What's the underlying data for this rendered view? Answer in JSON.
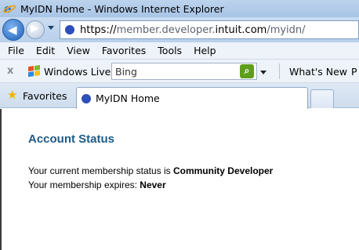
{
  "window": {
    "title": "MyIDN Home - Windows Internet Explorer"
  },
  "navigation": {
    "url_scheme": "https://",
    "url_prefix": "member.developer.",
    "url_host": "intuit.com",
    "url_path": "/myidn/"
  },
  "menu": [
    "File",
    "Edit",
    "View",
    "Favorites",
    "Tools",
    "Help"
  ],
  "toolbar": {
    "close_label": "x",
    "live_label": "Windows Live",
    "search_value": "Bing",
    "whats_new": "What's New",
    "overflow_label": "P"
  },
  "tabs": {
    "favorites_label": "Favorites",
    "active_tab_label": "MyIDN Home"
  },
  "content": {
    "heading": "Account Status",
    "status_prefix": "Your current membership status is ",
    "status_value": "Community Developer",
    "expire_prefix": "Your membership expires: ",
    "expire_value": "Never"
  },
  "colors": {
    "heading": "#1c5b87",
    "site_icon": "#2e4eb8",
    "search_go": "#5e9e1c"
  },
  "icons": [
    "ie-logo-icon",
    "back-arrow-icon",
    "forward-arrow-icon",
    "site-favicon-icon",
    "windows-live-icon",
    "search-go-icon",
    "favorites-star-icon"
  ]
}
